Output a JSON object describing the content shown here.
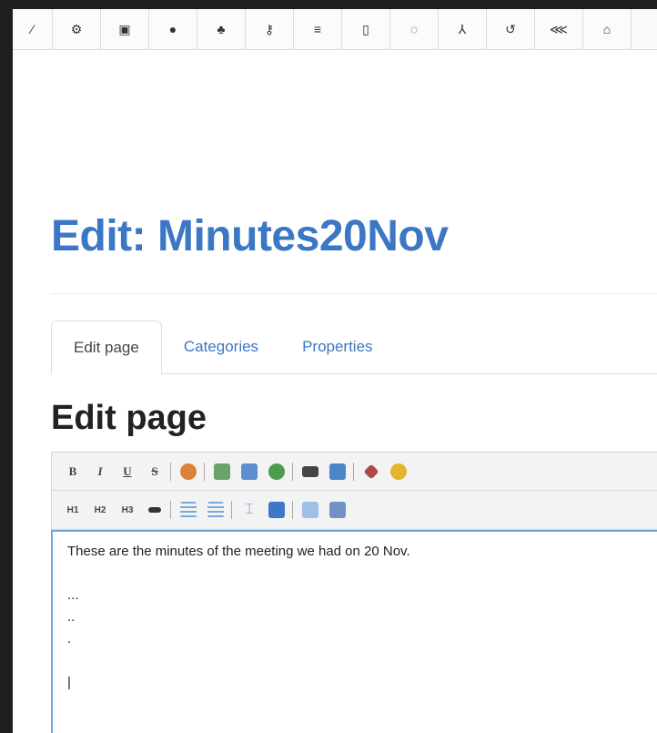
{
  "page": {
    "title": "Edit: Minutes20Nov",
    "section_heading": "Edit page"
  },
  "top_toolbar": {
    "buttons": [
      {
        "name": "wand-icon",
        "glyph": "⁄"
      },
      {
        "name": "gear-icon",
        "glyph": "⚙"
      },
      {
        "name": "image-icon",
        "glyph": "▣"
      },
      {
        "name": "user-icon",
        "glyph": "●"
      },
      {
        "name": "group-icon",
        "glyph": "♣"
      },
      {
        "name": "key-icon",
        "glyph": "⚷"
      },
      {
        "name": "list-icon",
        "glyph": "≡"
      },
      {
        "name": "clipboard-icon",
        "glyph": "▯"
      },
      {
        "name": "spinner-icon",
        "glyph": "◌"
      },
      {
        "name": "tree-icon",
        "glyph": "⅄"
      },
      {
        "name": "undo-icon",
        "glyph": "↺"
      },
      {
        "name": "share-icon",
        "glyph": "⋘"
      },
      {
        "name": "home-icon",
        "glyph": "⌂"
      }
    ]
  },
  "tabs": [
    {
      "label": "Edit page",
      "active": true
    },
    {
      "label": "Categories",
      "active": false
    },
    {
      "label": "Properties",
      "active": false
    }
  ],
  "editor_toolbar": {
    "row1": [
      {
        "name": "bold-icon",
        "glyph": "B"
      },
      {
        "name": "italic-icon",
        "glyph": "I"
      },
      {
        "name": "underline-icon",
        "glyph": "U"
      },
      {
        "name": "strikethrough-icon",
        "glyph": "S"
      }
    ],
    "row2": [
      {
        "name": "heading1-icon",
        "glyph": "H1"
      },
      {
        "name": "heading2-icon",
        "glyph": "H2"
      },
      {
        "name": "heading3-icon",
        "glyph": "H3"
      }
    ]
  },
  "editor": {
    "lines": [
      "These are the minutes of the meeting we had on 20 Nov.",
      "",
      "...",
      "..",
      ".",
      "",
      "|"
    ]
  }
}
